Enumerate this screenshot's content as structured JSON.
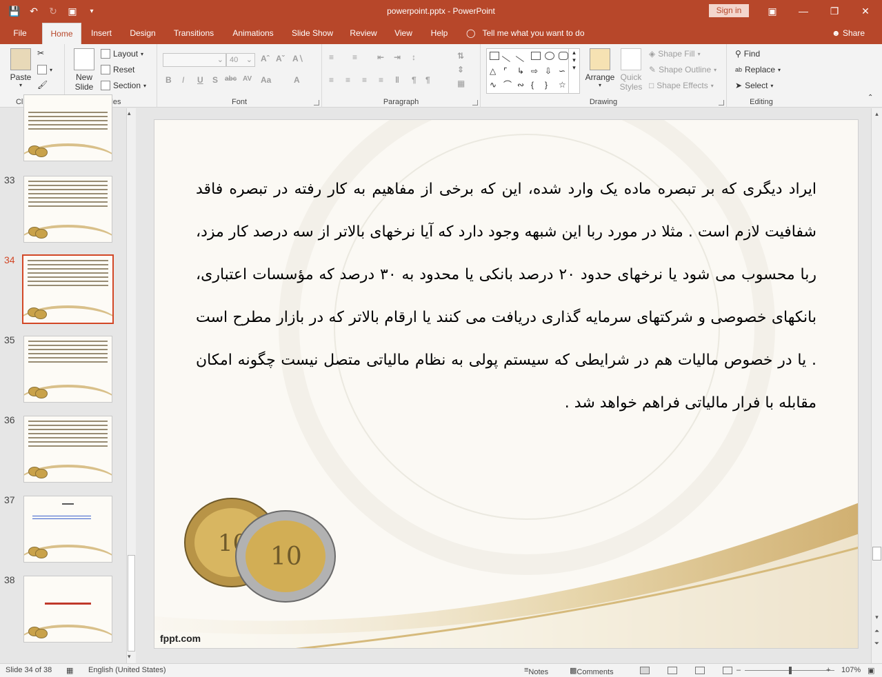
{
  "app": {
    "window_title": "powerpoint.pptx - PowerPoint",
    "sign_in_label": "Sign in"
  },
  "tabs": [
    {
      "label": "File"
    },
    {
      "label": "Home"
    },
    {
      "label": "Insert"
    },
    {
      "label": "Design"
    },
    {
      "label": "Transitions"
    },
    {
      "label": "Animations"
    },
    {
      "label": "Slide Show"
    },
    {
      "label": "Review"
    },
    {
      "label": "View"
    },
    {
      "label": "Help"
    }
  ],
  "tell_me": "Tell me what you want to do",
  "share_label": "Share",
  "ribbon": {
    "clipboard": {
      "label": "Clipboard",
      "paste": "Paste"
    },
    "slides": {
      "label": "Slides",
      "new_slide_1": "New",
      "new_slide_2": "Slide",
      "layout": "Layout",
      "reset": "Reset",
      "section": "Section"
    },
    "font": {
      "label": "Font",
      "font_size": "40"
    },
    "paragraph": {
      "label": "Paragraph"
    },
    "drawing": {
      "label": "Drawing",
      "arrange": "Arrange",
      "quick_styles_1": "Quick",
      "quick_styles_2": "Styles",
      "shape_fill": "Shape Fill",
      "shape_outline": "Shape Outline",
      "shape_effects": "Shape Effects"
    },
    "editing": {
      "label": "Editing",
      "find": "Find",
      "replace": "Replace",
      "select": "Select"
    }
  },
  "thumbnails": [
    {
      "number": "33"
    },
    {
      "number": "34"
    },
    {
      "number": "35"
    },
    {
      "number": "36"
    },
    {
      "number": "37"
    },
    {
      "number": "38"
    }
  ],
  "slide": {
    "body_text": "ایراد دیگری که بر تبصره ماده یک وارد شده، این که برخی از مفاهیم به کار رفته در تبصره فاقد شفافیت لازم است . مثلا در مورد ربا این شبهه وجود دارد که آیا نرخهای بالاتر از سه درصد کار مزد، ربا محسوب می شود یا نرخهای حدود ۲۰ درصد بانکی یا محدود به ۳۰ درصد که مؤسسات اعتباری، بانکهای خصوصی و شرکتهای سرمایه گذاری دریافت می کنند یا ارقام بالاتر که در بازار مطرح است . یا در خصوص مالیات هم در شرایطی که سیستم پولی به نظام مالیاتی متصل نیست چگونه امکان مقابله با فرار مالیاتی فراهم خواهد شد .",
    "footer": "fppt.com"
  },
  "status": {
    "slide_indicator": "Slide 34 of 38",
    "language": "English (United States)",
    "notes": "Notes",
    "comments": "Comments",
    "zoom": "107%"
  },
  "colors": {
    "accent": "#b7472a",
    "selected_thumb": "#d24726"
  }
}
